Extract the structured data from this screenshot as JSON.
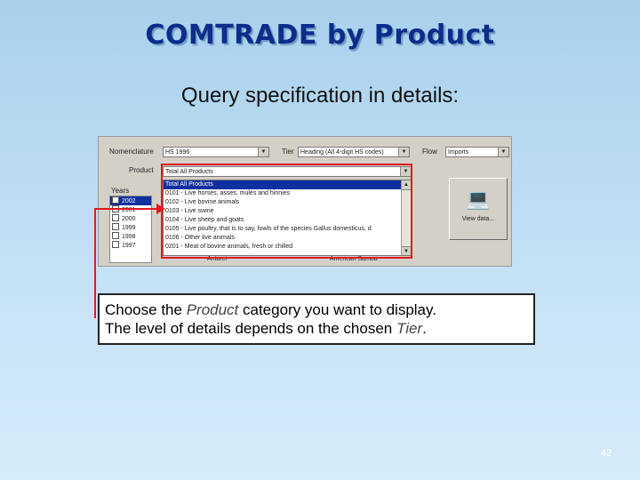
{
  "title": "COMTRADE by Product",
  "subtitle": "Query specification in details:",
  "form": {
    "nomenclature_label": "Nomenclature",
    "nomenclature_value": "HS 1996",
    "tier_label": "Tier",
    "tier_value": "Heading (All 4-digit HS codes)",
    "flow_label": "Flow",
    "flow_value": "Imports",
    "product_label": "Product",
    "product_value": "Total All Products",
    "years_label": "Years",
    "years": [
      "2002",
      "2001",
      "2000",
      "1999",
      "1998",
      "1997"
    ],
    "products": [
      "Total All Products",
      "0101 - Live horses, asses, mules and hinnies",
      "0102 - Live bovine animals",
      "0103 - Live swine",
      "0104 - Live sheep and goats",
      "0105 - Live poultry, that is to say, fowls of the species Gallus domesticus, d",
      "0106 - Other live animals",
      "0201 - Meat of bovine animals, fresh or chilled"
    ],
    "bottom_left": "Antarct",
    "bottom_right": "American Samoa",
    "view_button_label": "View data..."
  },
  "callout": {
    "line1_pre": "Choose the ",
    "line1_em": "Product",
    "line1_post": " category you want to display.",
    "line2_pre": "The level of details depends on the chosen ",
    "line2_em": "Tier",
    "line2_post": "."
  },
  "page_number": "42",
  "colors": {
    "title": "#0b2d8c",
    "highlight": "#e01b1b",
    "selection": "#1030a0"
  }
}
